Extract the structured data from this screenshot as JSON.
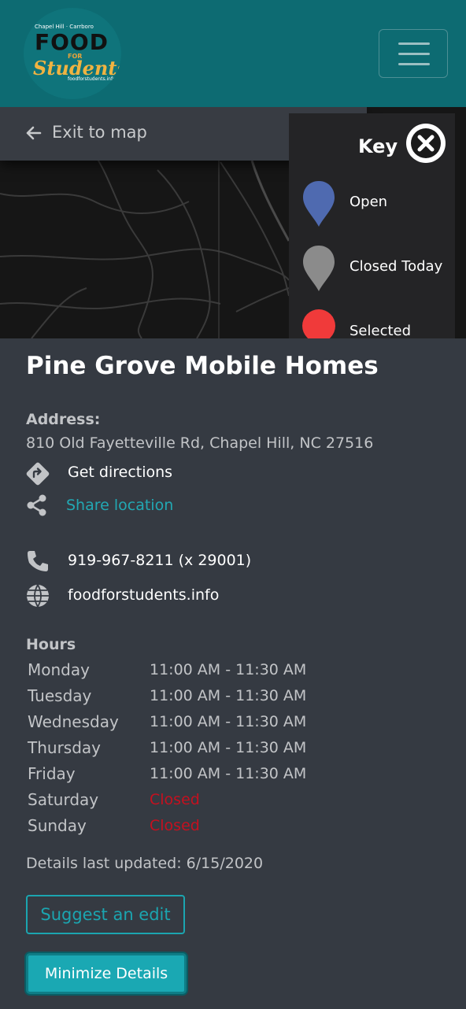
{
  "header": {
    "logo": {
      "top_text": "Chapel Hill · Carrboro",
      "food": "FOOD",
      "for": "FOR",
      "students": "Students",
      "url": "foodforstudents.info"
    },
    "menu_icon": "hamburger-icon"
  },
  "map": {
    "exit_label": "Exit to map",
    "exit_icon": "arrow-left-icon",
    "key": {
      "title": "Key",
      "close_icon": "close-icon",
      "items": [
        {
          "label": "Open",
          "color": "#4f6ab0",
          "icon": "pin-icon"
        },
        {
          "label": "Closed Today",
          "color": "#8b8b8b",
          "icon": "pin-icon"
        },
        {
          "label": "Selected",
          "color": "#f03a3a",
          "icon": "dot-icon"
        }
      ]
    }
  },
  "details": {
    "title": "Pine Grove Mobile Homes",
    "address_label": "Address:",
    "address": "810 Old Fayetteville Rd, Chapel Hill, NC 27516",
    "directions_label": "Get directions",
    "share_label": "Share location",
    "phone": "919-967-8211 (x 29001)",
    "website": "foodforstudents.info",
    "hours_label": "Hours",
    "hours": [
      {
        "day": "Monday",
        "time": "11:00 AM - 11:30 AM"
      },
      {
        "day": "Tuesday",
        "time": "11:00 AM - 11:30 AM"
      },
      {
        "day": "Wednesday",
        "time": "11:00 AM - 11:30 AM"
      },
      {
        "day": "Thursday",
        "time": "11:00 AM - 11:30 AM"
      },
      {
        "day": "Friday",
        "time": "11:00 AM - 11:30 AM"
      },
      {
        "day": "Saturday",
        "time": "Closed"
      },
      {
        "day": "Sunday",
        "time": "Closed"
      }
    ],
    "updated": "Details last updated: 6/15/2020",
    "suggest_label": "Suggest an edit",
    "minimize_label": "Minimize Details"
  },
  "colors": {
    "header_bg": "#0d6b72",
    "panel_bg": "#353a42",
    "accent": "#1aa8b3",
    "closed_red": "#c5101f"
  }
}
